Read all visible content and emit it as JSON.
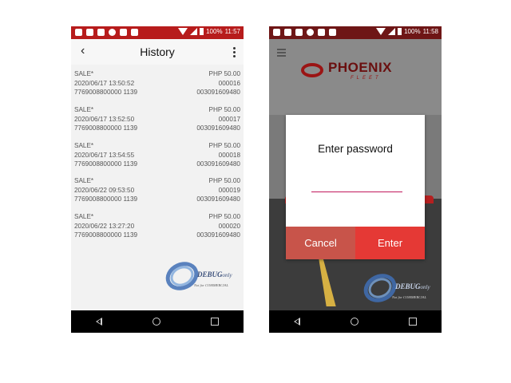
{
  "phone1": {
    "status": {
      "battery": "100%",
      "time": "11:57"
    },
    "title": "History",
    "transactions": [
      {
        "type": "SALE*",
        "amount": "PHP 50.00",
        "datetime": "2020/06/17 13:50:52",
        "ref": "000016",
        "card": "7769008800000 1139",
        "terminal": "003091609480"
      },
      {
        "type": "SALE*",
        "amount": "PHP 50.00",
        "datetime": "2020/06/17 13:52:50",
        "ref": "000017",
        "card": "7769008800000 1139",
        "terminal": "003091609480"
      },
      {
        "type": "SALE*",
        "amount": "PHP 50.00",
        "datetime": "2020/06/17 13:54:55",
        "ref": "000018",
        "card": "7769008800000 1139",
        "terminal": "003091609480"
      },
      {
        "type": "SALE*",
        "amount": "PHP 50.00",
        "datetime": "2020/06/22 09:53:50",
        "ref": "000019",
        "card": "7769008800000 1139",
        "terminal": "003091609480"
      },
      {
        "type": "SALE*",
        "amount": "PHP 50.00",
        "datetime": "2020/06/22 13:27:20",
        "ref": "000020",
        "card": "7769008800000 1139",
        "terminal": "003091609480"
      }
    ],
    "watermark": {
      "main": "DEBUG",
      "suffix": "only",
      "sub": "Not for COMMERCIAL"
    }
  },
  "phone2": {
    "status": {
      "battery": "100%",
      "time": "11:58"
    },
    "logo": {
      "name": "PHOENIX",
      "tag": "FLEET"
    },
    "dialog": {
      "title": "Enter password",
      "password_value": "",
      "cancel_label": "Cancel",
      "enter_label": "Enter"
    },
    "watermark": {
      "main": "DEBUG",
      "suffix": "only",
      "sub": "Not for COMMERCIAL"
    }
  },
  "colors": {
    "statusbar": "#b71c1c",
    "accent": "#e53935",
    "cancel": "#c8544a",
    "underline": "#c2185b"
  }
}
